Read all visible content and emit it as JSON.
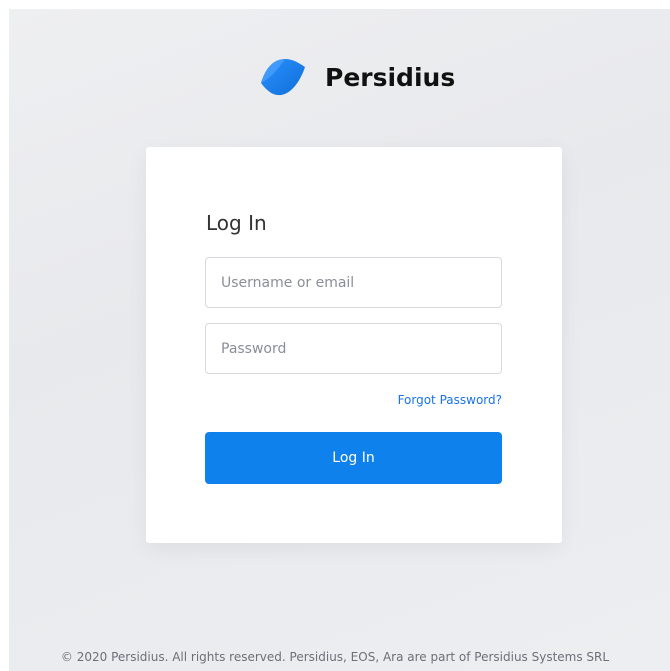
{
  "brand": {
    "name": "Persidius",
    "logo_icon": "persidius-logo-icon",
    "logo_color": "#1a7fe8"
  },
  "login": {
    "title": "Log In",
    "username_placeholder": "Username or email",
    "username_value": "",
    "password_placeholder": "Password",
    "password_value": "",
    "forgot_label": "Forgot Password?",
    "submit_label": "Log In"
  },
  "colors": {
    "accent": "#0f81ec",
    "link": "#1a73e8",
    "background": "#eceef1",
    "card": "#ffffff"
  },
  "footer": {
    "text": "© 2020 Persidius. All rights reserved. Persidius, EOS, Ara are part of Persidius Systems SRL"
  }
}
